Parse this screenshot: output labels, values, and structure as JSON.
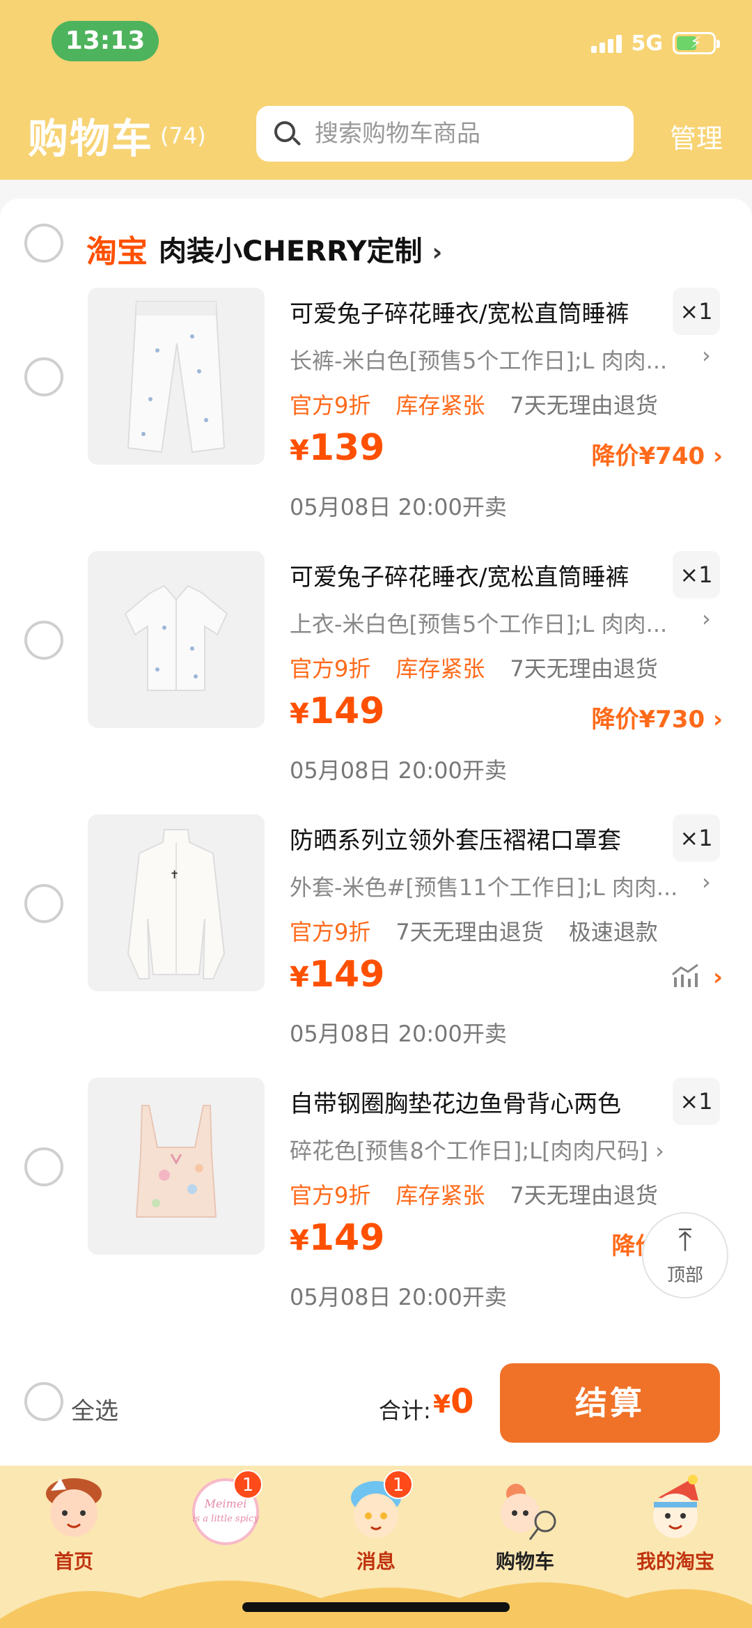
{
  "status_bar": {
    "time": "13:13",
    "network": "5G"
  },
  "header": {
    "title": "购物车",
    "count": "(74)",
    "search_placeholder": "搜索购物车商品",
    "manage": "管理"
  },
  "shop": {
    "platform": "淘宝",
    "name": "肉装小CHERRY定制",
    "chevron": "›"
  },
  "items": [
    {
      "title": "可爱兔子碎花睡衣/宽松直筒睡裤",
      "qty": "×1",
      "sku": "长裤-米白色[预售5个工作日];L 肉肉...",
      "tags": [
        "官方9折",
        "库存紧张",
        "7天无理由退货"
      ],
      "price_symbol": "¥",
      "price": "139",
      "price_drop": "降价¥740 ›",
      "sale_time": "05月08日 20:00开卖"
    },
    {
      "title": "可爱兔子碎花睡衣/宽松直筒睡裤",
      "qty": "×1",
      "sku": "上衣-米白色[预售5个工作日];L 肉肉...",
      "tags": [
        "官方9折",
        "库存紧张",
        "7天无理由退货"
      ],
      "price_symbol": "¥",
      "price": "149",
      "price_drop": "降价¥730 ›",
      "sale_time": "05月08日 20:00开卖"
    },
    {
      "title": "防晒系列立领外套压褶裙口罩套",
      "qty": "×1",
      "sku": "外套-米色#[预售11个工作日];L 肉肉...",
      "tags": [
        "官方9折",
        "7天无理由退货",
        "极速退款"
      ],
      "price_symbol": "¥",
      "price": "149",
      "price_drop": "›",
      "sale_time": "05月08日 20:00开卖"
    },
    {
      "title": "自带钢圈胸垫花边鱼骨背心两色",
      "qty": "×1",
      "sku": "碎花色[预售8个工作日];L[肉肉尺码] ›",
      "tags": [
        "官方9折",
        "库存紧张",
        "7天无理由退货"
      ],
      "price_symbol": "¥",
      "price": "149",
      "price_drop": "降价¥",
      "sale_time": "05月08日 20:00开卖"
    }
  ],
  "back_to_top": {
    "arrow": "⤒",
    "label": "顶部"
  },
  "checkout": {
    "select_all": "全选",
    "total_label": "合计:",
    "total_symbol": "¥",
    "total_value": "0",
    "button": "结算"
  },
  "tabs": [
    {
      "label": "首页",
      "badge": "",
      "icon": "home-mascot-icon"
    },
    {
      "label": "",
      "badge": "1",
      "icon": "meimei-avatar-icon",
      "avatar_text": "Meimei is a little spicy"
    },
    {
      "label": "消息",
      "badge": "1",
      "icon": "message-mascot-icon"
    },
    {
      "label": "购物车",
      "badge": "",
      "icon": "cart-mascot-icon"
    },
    {
      "label": "我的淘宝",
      "badge": "",
      "icon": "profile-mascot-icon"
    }
  ],
  "colors": {
    "header_bg": "#f7d374",
    "accent": "#ff5000",
    "checkout_button": "#f07228",
    "tabbar_bg": "#fbe7b2",
    "time_pill": "#4db35c"
  }
}
